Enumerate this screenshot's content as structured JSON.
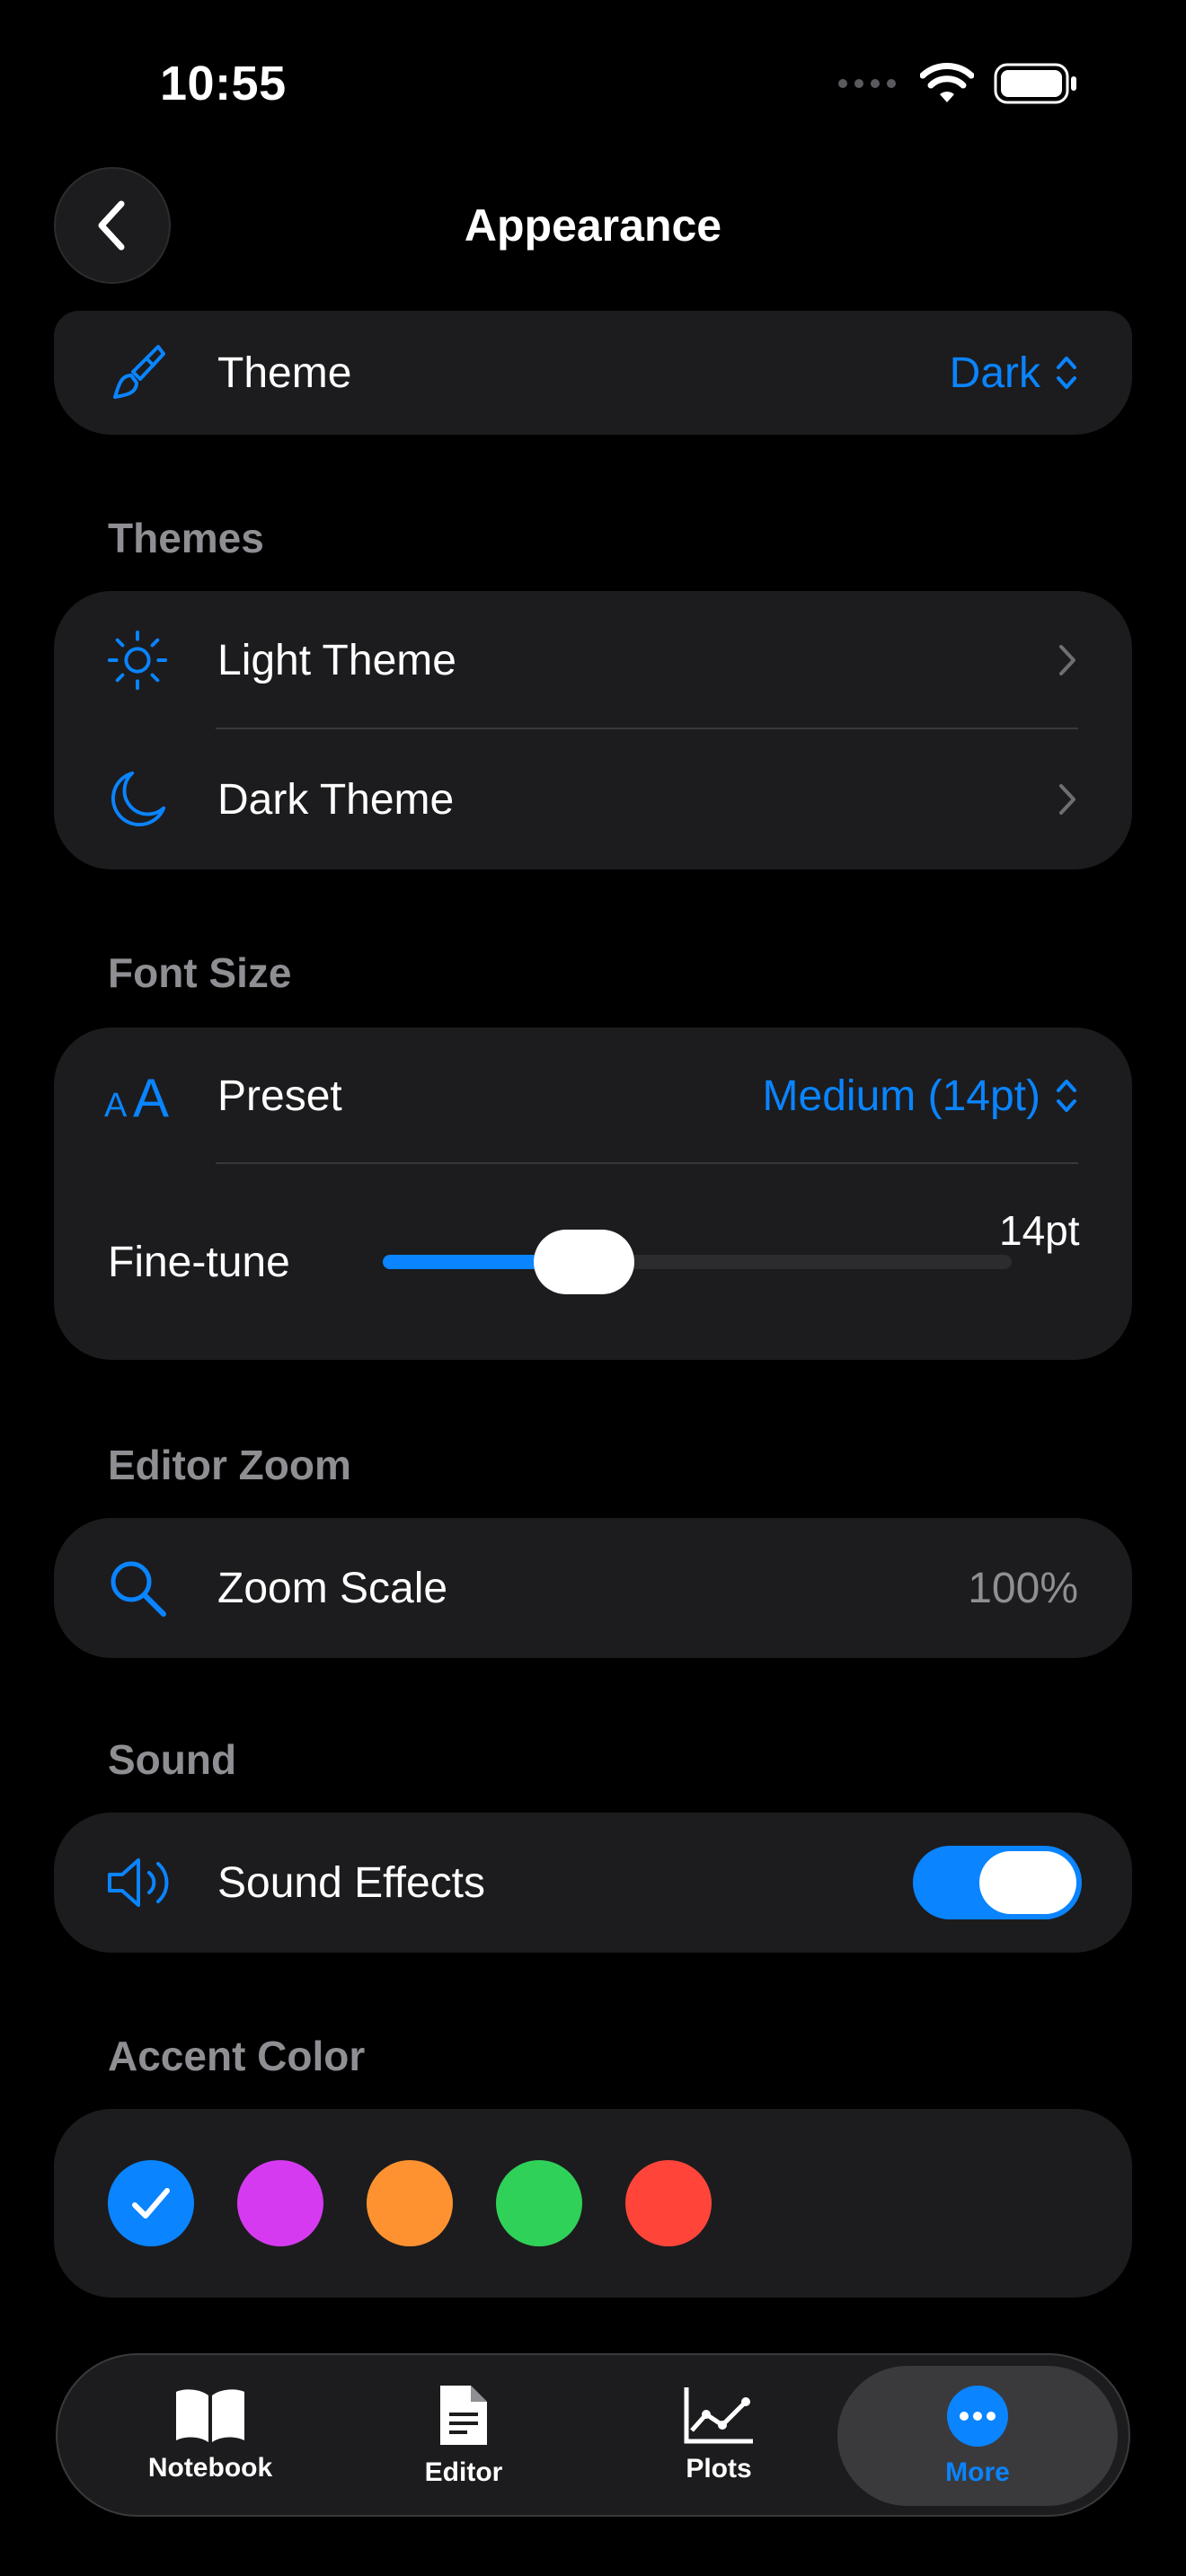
{
  "status_bar": {
    "time": "10:55"
  },
  "nav": {
    "title": "Appearance"
  },
  "theme_row": {
    "label": "Theme",
    "value": "Dark"
  },
  "themes_section": {
    "header": "Themes",
    "items": [
      {
        "label": "Light Theme"
      },
      {
        "label": "Dark Theme"
      }
    ]
  },
  "font_size_section": {
    "header": "Font Size",
    "preset_label": "Preset",
    "preset_value": "Medium (14pt)",
    "finetune_label": "Fine-tune",
    "finetune_value": "14pt",
    "slider_fraction": 0.32
  },
  "editor_zoom_section": {
    "header": "Editor Zoom",
    "zoom_label": "Zoom Scale",
    "zoom_value": "100%"
  },
  "sound_section": {
    "header": "Sound",
    "label": "Sound Effects",
    "enabled": true
  },
  "accent_section": {
    "header": "Accent Color",
    "colors": [
      "#0a84ff",
      "#d63af0",
      "#ff9230",
      "#30d158",
      "#ff453a"
    ],
    "selected_index": 0
  },
  "tab_bar": {
    "tabs": [
      {
        "label": "Notebook",
        "icon": "book-icon"
      },
      {
        "label": "Editor",
        "icon": "document-icon"
      },
      {
        "label": "Plots",
        "icon": "chart-icon"
      },
      {
        "label": "More",
        "icon": "ellipsis-icon"
      }
    ],
    "active_index": 3
  },
  "colors": {
    "accent": "#0a84ff",
    "card": "#1c1c1e",
    "secondary_text": "#8e8e93"
  }
}
